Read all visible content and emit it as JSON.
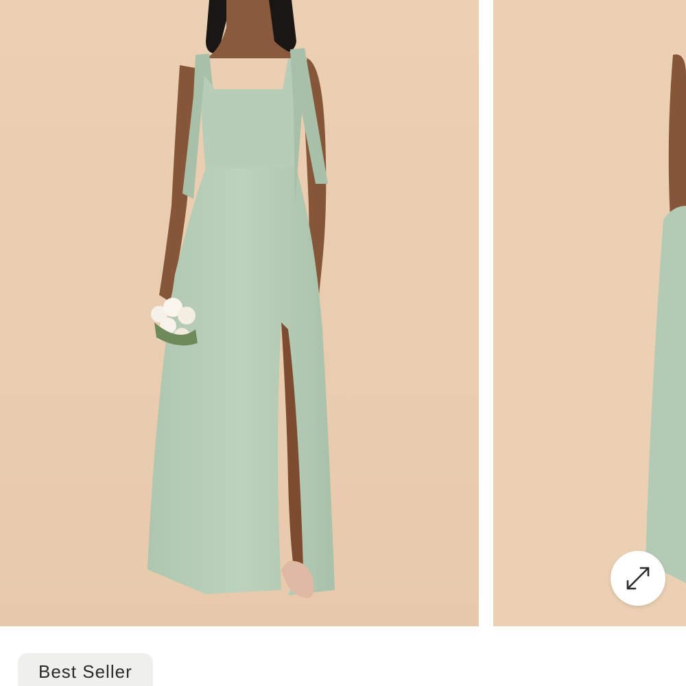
{
  "product": {
    "badge_label": "Best Seller"
  },
  "gallery": {
    "slide_count_visible": 2,
    "expand_icon": "expand-arrows-icon"
  },
  "colors": {
    "backdrop": "#ecd0b4",
    "dress": "#b7cdb8",
    "badge_background": "#efefec",
    "badge_text": "#2a2a2a"
  }
}
